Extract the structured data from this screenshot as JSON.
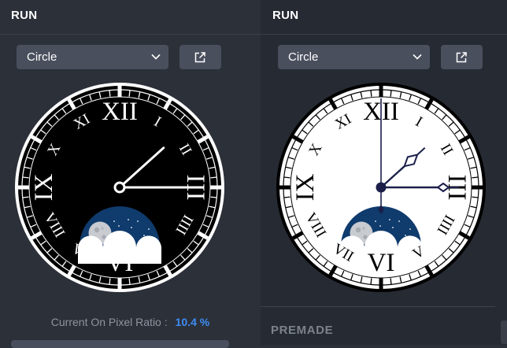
{
  "left": {
    "header": "RUN",
    "shape_select": {
      "value": "Circle"
    },
    "pixel_ratio": {
      "label": "Current On Pixel Ratio :",
      "value": "10.4 %"
    }
  },
  "right": {
    "header": "RUN",
    "shape_select": {
      "value": "Circle"
    },
    "section_title": "PREMADE"
  },
  "numerals": [
    "XII",
    "I",
    "II",
    "III",
    "IIII",
    "V",
    "VI",
    "VII",
    "VIII",
    "IX",
    "X",
    "XI"
  ],
  "left_clock": {
    "face": "#000000",
    "ink": "#ffffff",
    "hour_hand_minutes": 128,
    "minute_hand_minutes": 15
  },
  "right_clock": {
    "face": "#ffffff",
    "ink": "#000000",
    "hands": "#1b1f4a",
    "hour_hand_minutes": 128,
    "minute_hand_minutes": 15,
    "second_hand_minutes": 0
  },
  "moon_dial": {
    "sky": "#0f3b6d",
    "moon": "#c8cbd0"
  },
  "colors": {
    "accent": "#3d8df5",
    "button": "#4a4f5d"
  },
  "icons": {
    "dropdown": "chevron-down-icon",
    "external": "external-link-icon"
  }
}
